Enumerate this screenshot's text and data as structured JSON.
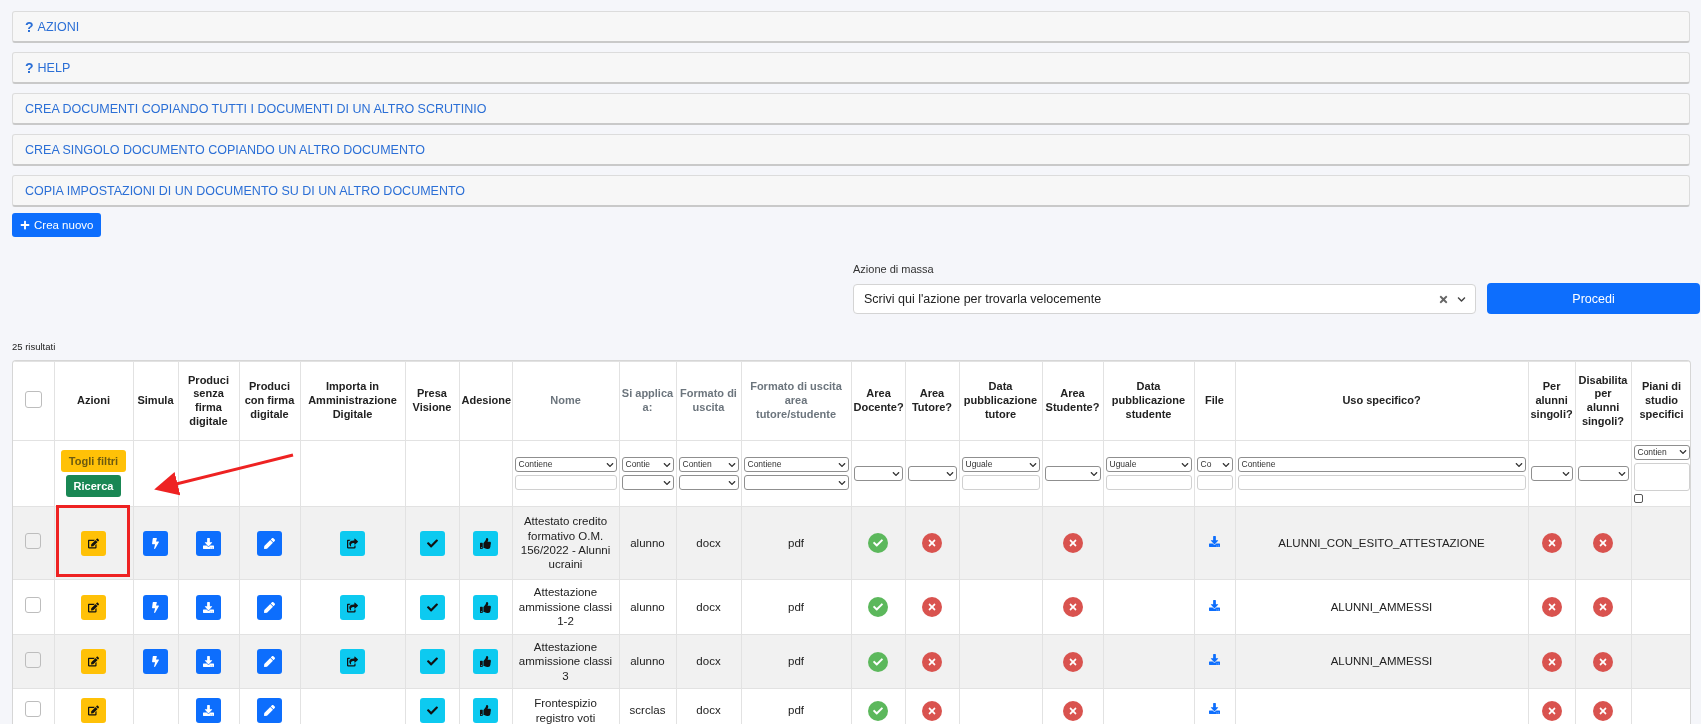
{
  "panels": [
    {
      "prefix": "?",
      "label": "AZIONI"
    },
    {
      "prefix": "?",
      "label": "HELP"
    },
    {
      "label": "CREA DOCUMENTI COPIANDO TUTTI I DOCUMENTI DI UN ALTRO SCRUTINIO"
    },
    {
      "label": "CREA SINGOLO DOCUMENTO COPIANDO UN ALTRO DOCUMENTO"
    },
    {
      "label": "COPIA IMPOSTAZIONI DI UN DOCUMENTO SU DI UN ALTRO DOCUMENTO"
    }
  ],
  "create_button": {
    "label": "Crea nuovo"
  },
  "mass_action": {
    "label": "Azione di massa",
    "placeholder": "Scrivi qui l'azione per trovarla velocemente",
    "button": "Procedi"
  },
  "results_count": "25 risultati",
  "table": {
    "select_all": {
      "checked": false
    },
    "columns": [
      {
        "kind": "checkbox"
      },
      {
        "title": "Azioni",
        "sortable": false,
        "filters": [
          {
            "kind": "button",
            "label": "Togli filtri"
          },
          {
            "kind": "button",
            "label": "Ricerca"
          }
        ]
      },
      {
        "title": "Simula",
        "sortable": false
      },
      {
        "title": "Produci senza firma digitale",
        "sortable": false
      },
      {
        "title": "Produci con firma digitale",
        "sortable": false
      },
      {
        "title": "Importa in Amministrazione Digitale",
        "sortable": false
      },
      {
        "title": "Presa Visione",
        "sortable": false
      },
      {
        "title": "Adesione",
        "sortable": false
      },
      {
        "title": "Nome",
        "sortable": true,
        "filters": [
          {
            "kind": "select",
            "value": "Contiene"
          },
          {
            "kind": "input"
          }
        ]
      },
      {
        "title": "Si applica a:",
        "sortable": true,
        "filters": [
          {
            "kind": "select",
            "value": "Contie"
          },
          {
            "kind": "select"
          }
        ]
      },
      {
        "title": "Formato di uscita",
        "sortable": true,
        "filters": [
          {
            "kind": "select",
            "value": "Contien"
          },
          {
            "kind": "select"
          }
        ]
      },
      {
        "title": "Formato di uscita area tutore/studente",
        "sortable": true,
        "filters": [
          {
            "kind": "select",
            "value": "Contiene"
          },
          {
            "kind": "select"
          }
        ]
      },
      {
        "title": "Area Docente?",
        "sortable": false,
        "filters": [
          {
            "kind": "select"
          }
        ]
      },
      {
        "title": "Area Tutore?",
        "sortable": false,
        "filters": [
          {
            "kind": "select"
          }
        ]
      },
      {
        "title": "Data pubblicazione tutore",
        "sortable": false,
        "filters": [
          {
            "kind": "select",
            "value": "Uguale"
          },
          {
            "kind": "input"
          }
        ]
      },
      {
        "title": "Area Studente?",
        "sortable": false,
        "filters": [
          {
            "kind": "select"
          }
        ]
      },
      {
        "title": "Data pubblicazione studente",
        "sortable": false,
        "filters": [
          {
            "kind": "select",
            "value": "Uguale"
          },
          {
            "kind": "input"
          }
        ]
      },
      {
        "title": "File",
        "sortable": false,
        "filters": [
          {
            "kind": "select",
            "value": "Co"
          },
          {
            "kind": "input"
          }
        ]
      },
      {
        "title": "Uso specifico?",
        "sortable": false,
        "filters": [
          {
            "kind": "select",
            "value": "Contiene"
          },
          {
            "kind": "input"
          }
        ]
      },
      {
        "title": "Per alunni singoli?",
        "sortable": false,
        "filters": [
          {
            "kind": "select"
          }
        ]
      },
      {
        "title": "Disabilita per alunni singoli?",
        "sortable": false,
        "filters": [
          {
            "kind": "select"
          }
        ]
      },
      {
        "title": "Piani di studio specifici",
        "sortable": false,
        "filters": [
          {
            "kind": "select",
            "value": "Contien"
          },
          {
            "kind": "textarea"
          },
          {
            "kind": "checkbox",
            "checked": false
          }
        ]
      }
    ],
    "rows": [
      {
        "cells": [
          {
            "kind": "checkbox",
            "checked": false
          },
          {
            "kind": "action"
          },
          {
            "kind": "action"
          },
          {
            "kind": "action"
          },
          {
            "kind": "action"
          },
          {
            "kind": "action"
          },
          {
            "kind": "action"
          },
          {
            "kind": "action"
          },
          {
            "kind": "text",
            "text": "Attestato credito formativo O.M. 156/2022 - Alunni ucraini"
          },
          {
            "kind": "text",
            "text": "alunno"
          },
          {
            "kind": "text",
            "text": "docx"
          },
          {
            "kind": "text",
            "text": "pdf"
          },
          {
            "kind": "flag",
            "yes": true
          },
          {
            "kind": "flag",
            "yes": false
          },
          {
            "kind": "empty"
          },
          {
            "kind": "flag",
            "yes": false
          },
          {
            "kind": "empty"
          },
          {
            "kind": "file"
          },
          {
            "kind": "text",
            "text": "ALUNNI_CON_ESITO_ATTESTAZIONE"
          },
          {
            "kind": "flag",
            "yes": false
          },
          {
            "kind": "flag",
            "yes": false
          },
          {
            "kind": "empty"
          }
        ]
      },
      {
        "cells": [
          {
            "kind": "checkbox",
            "checked": false
          },
          {
            "kind": "action"
          },
          {
            "kind": "action"
          },
          {
            "kind": "action"
          },
          {
            "kind": "action"
          },
          {
            "kind": "action"
          },
          {
            "kind": "action"
          },
          {
            "kind": "action"
          },
          {
            "kind": "text",
            "text": "Attestazione ammissione classi 1-2"
          },
          {
            "kind": "text",
            "text": "alunno"
          },
          {
            "kind": "text",
            "text": "docx"
          },
          {
            "kind": "text",
            "text": "pdf"
          },
          {
            "kind": "flag",
            "yes": true
          },
          {
            "kind": "flag",
            "yes": false
          },
          {
            "kind": "empty"
          },
          {
            "kind": "flag",
            "yes": false
          },
          {
            "kind": "empty"
          },
          {
            "kind": "file"
          },
          {
            "kind": "text",
            "text": "ALUNNI_AMMESSI"
          },
          {
            "kind": "flag",
            "yes": false
          },
          {
            "kind": "flag",
            "yes": false
          },
          {
            "kind": "empty"
          }
        ]
      },
      {
        "cells": [
          {
            "kind": "checkbox",
            "checked": false
          },
          {
            "kind": "action"
          },
          {
            "kind": "action"
          },
          {
            "kind": "action"
          },
          {
            "kind": "action"
          },
          {
            "kind": "action"
          },
          {
            "kind": "action"
          },
          {
            "kind": "action"
          },
          {
            "kind": "text",
            "text": "Attestazione ammissione classi 3"
          },
          {
            "kind": "text",
            "text": "alunno"
          },
          {
            "kind": "text",
            "text": "docx"
          },
          {
            "kind": "text",
            "text": "pdf"
          },
          {
            "kind": "flag",
            "yes": true
          },
          {
            "kind": "flag",
            "yes": false
          },
          {
            "kind": "empty"
          },
          {
            "kind": "flag",
            "yes": false
          },
          {
            "kind": "empty"
          },
          {
            "kind": "file"
          },
          {
            "kind": "text",
            "text": "ALUNNI_AMMESSI"
          },
          {
            "kind": "flag",
            "yes": false
          },
          {
            "kind": "flag",
            "yes": false
          },
          {
            "kind": "empty"
          }
        ]
      },
      {
        "cells": [
          {
            "kind": "checkbox",
            "checked": false
          },
          {
            "kind": "action"
          },
          {
            "kind": "empty"
          },
          {
            "kind": "action"
          },
          {
            "kind": "action"
          },
          {
            "kind": "empty"
          },
          {
            "kind": "action"
          },
          {
            "kind": "action"
          },
          {
            "kind": "text",
            "text": "Frontespizio registro voti"
          },
          {
            "kind": "text",
            "text": "scrclas"
          },
          {
            "kind": "text",
            "text": "docx"
          },
          {
            "kind": "text",
            "text": "pdf"
          },
          {
            "kind": "flag",
            "yes": true
          },
          {
            "kind": "flag",
            "yes": false
          },
          {
            "kind": "empty"
          },
          {
            "kind": "flag",
            "yes": false
          },
          {
            "kind": "empty"
          },
          {
            "kind": "file"
          },
          {
            "kind": "empty"
          },
          {
            "kind": "flag",
            "yes": false
          },
          {
            "kind": "flag",
            "yes": false
          },
          {
            "kind": "empty"
          }
        ]
      }
    ]
  }
}
